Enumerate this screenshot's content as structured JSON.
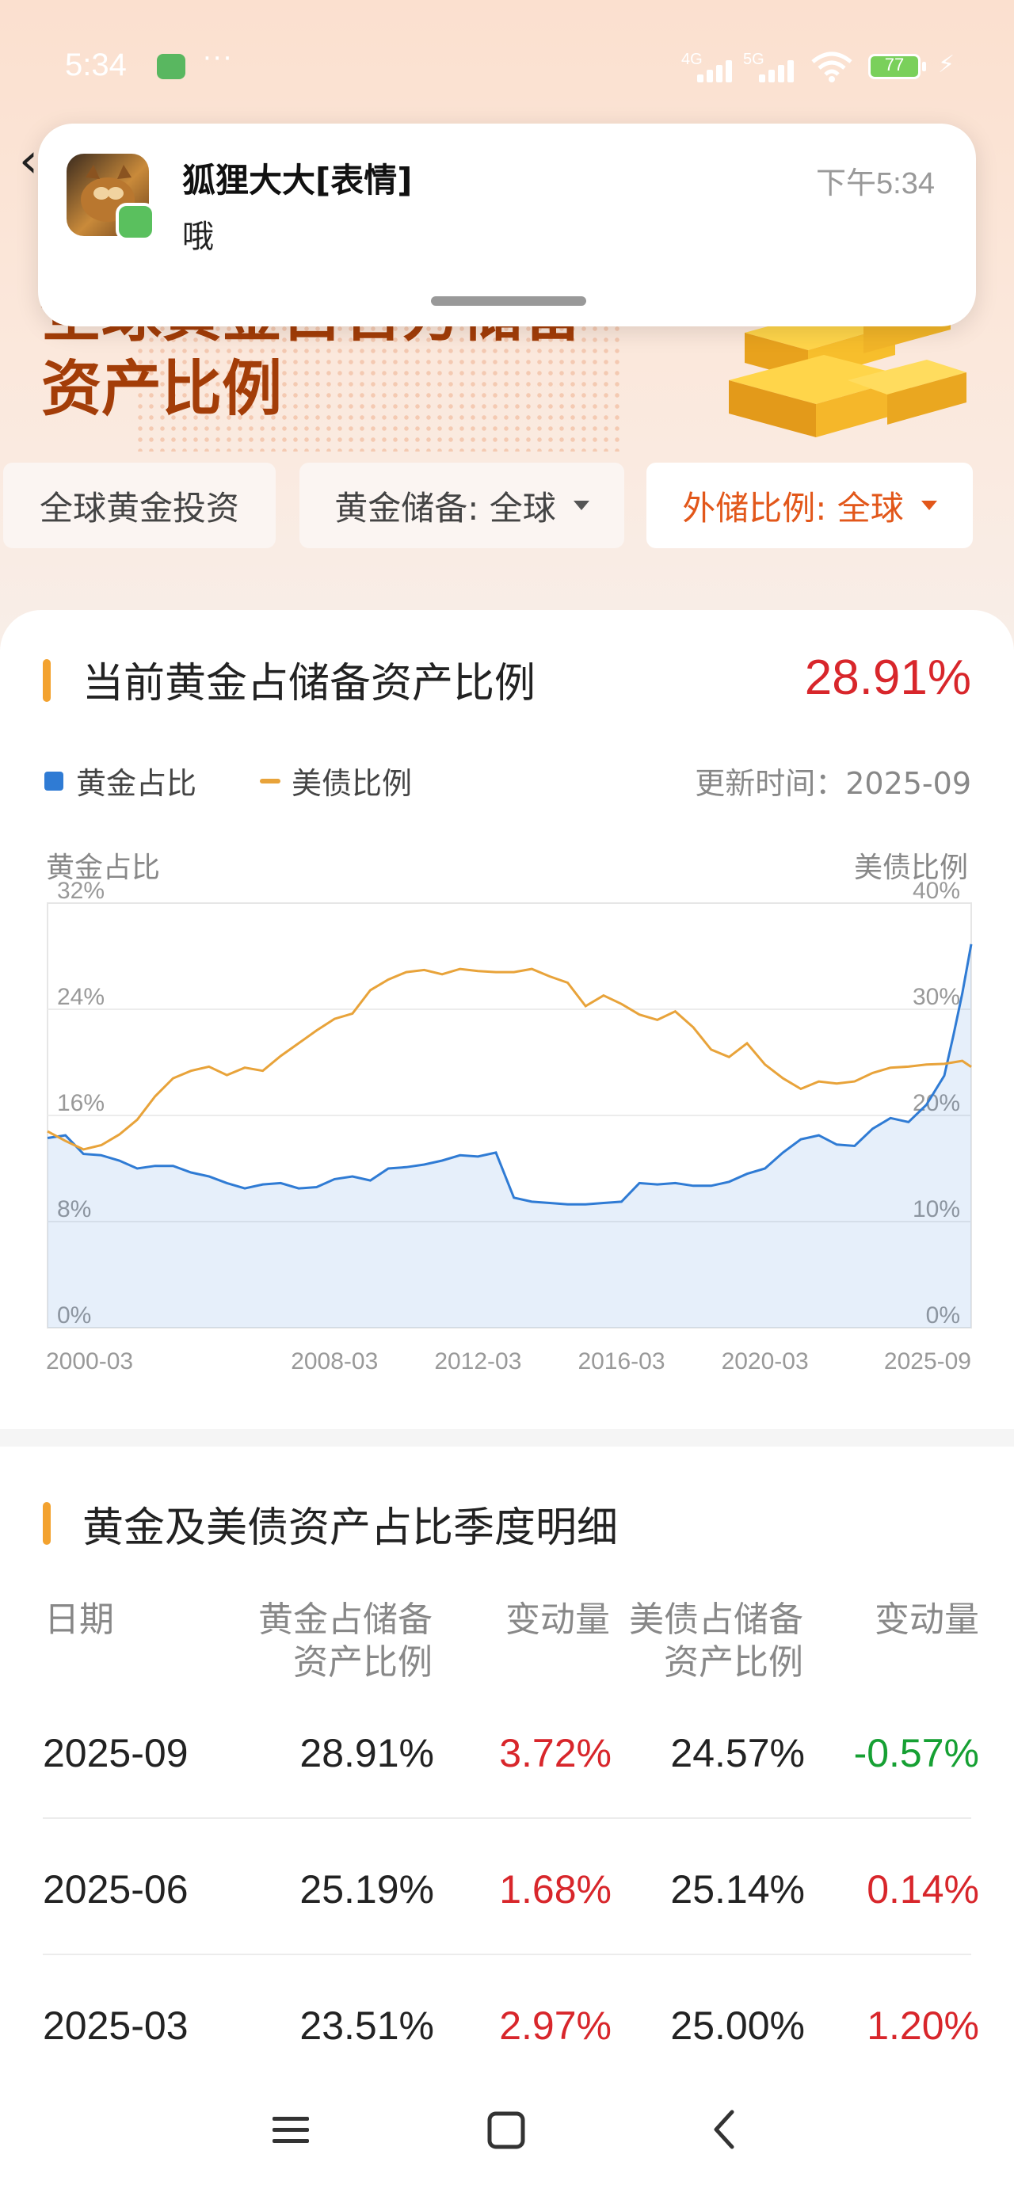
{
  "status_bar": {
    "time": "5:34",
    "dots": "···",
    "net1": "4G",
    "net2": "5G",
    "battery": "77"
  },
  "notification": {
    "sender": "狐狸大大[表情]",
    "message": "哦",
    "time": "下午5:34"
  },
  "hero": {
    "title_line1": "全球黄金占官方储备",
    "title_line2": "资产比例"
  },
  "tabs": [
    {
      "label": "全球黄金投资"
    },
    {
      "label": "黄金储备: 全球"
    },
    {
      "label": "外储比例: 全球"
    }
  ],
  "current": {
    "title": "当前黄金占储备资产比例",
    "value": "28.91%"
  },
  "legend": {
    "gold": "黄金占比",
    "treasury": "美债比例",
    "update": "更新时间：2025-09"
  },
  "colors": {
    "gold_series": "#2f7bd4",
    "treasury_series": "#e8a33a",
    "accent": "#e2571a",
    "up": "#d8262b",
    "down": "#16a033"
  },
  "chart_data": {
    "type": "line",
    "left_axis_title": "黄金占比",
    "right_axis_title": "美债比例",
    "left_ticks": [
      "32%",
      "24%",
      "16%",
      "8%",
      "0%"
    ],
    "right_ticks": [
      "40%",
      "30%",
      "20%",
      "10%",
      "0%"
    ],
    "x_ticks": [
      "2000-03",
      "2008-03",
      "2012-03",
      "2016-03",
      "2020-03",
      "2025-09"
    ],
    "left_range": [
      0,
      32
    ],
    "right_range": [
      0,
      40
    ],
    "x": [
      2000.0,
      2000.5,
      2001.0,
      2001.5,
      2002.0,
      2002.5,
      2003.0,
      2003.5,
      2004.0,
      2004.5,
      2005.0,
      2005.5,
      2006.0,
      2006.5,
      2007.0,
      2007.5,
      2008.0,
      2008.5,
      2009.0,
      2009.5,
      2010.0,
      2010.5,
      2011.0,
      2011.5,
      2012.0,
      2012.5,
      2013.0,
      2013.5,
      2014.0,
      2014.5,
      2015.0,
      2015.5,
      2016.0,
      2016.5,
      2017.0,
      2017.5,
      2018.0,
      2018.5,
      2019.0,
      2019.5,
      2020.0,
      2020.5,
      2021.0,
      2021.5,
      2022.0,
      2022.5,
      2023.0,
      2023.5,
      2024.0,
      2024.5,
      2025.0,
      2025.25,
      2025.5,
      2025.75
    ],
    "series": [
      {
        "name": "黄金占比",
        "axis": "left",
        "values": [
          14.3,
          14.5,
          13.1,
          13.0,
          12.6,
          12.0,
          12.2,
          12.2,
          11.7,
          11.4,
          10.9,
          10.5,
          10.8,
          10.9,
          10.5,
          10.6,
          11.2,
          11.4,
          11.1,
          12.0,
          12.1,
          12.3,
          12.6,
          13.0,
          12.9,
          13.2,
          9.8,
          9.5,
          9.4,
          9.3,
          9.3,
          9.4,
          9.5,
          10.9,
          10.8,
          10.9,
          10.7,
          10.7,
          11.0,
          11.6,
          12.0,
          13.2,
          14.2,
          14.5,
          13.8,
          13.7,
          15.0,
          15.8,
          15.5,
          16.8,
          19.0,
          22.0,
          25.19,
          28.91
        ]
      },
      {
        "name": "美债比例",
        "axis": "right",
        "values": [
          18.5,
          17.6,
          16.8,
          17.2,
          18.2,
          19.6,
          21.8,
          23.5,
          24.2,
          24.6,
          23.8,
          24.5,
          24.2,
          25.6,
          26.8,
          28.0,
          29.1,
          29.6,
          31.8,
          32.8,
          33.5,
          33.7,
          33.3,
          33.8,
          33.6,
          33.5,
          33.5,
          33.8,
          33.1,
          32.5,
          30.3,
          31.3,
          30.5,
          29.5,
          29.0,
          29.8,
          28.3,
          26.2,
          25.5,
          26.8,
          24.8,
          23.5,
          22.5,
          23.2,
          23.0,
          23.2,
          24.0,
          24.5,
          24.6,
          24.8,
          24.86,
          25.0,
          25.14,
          24.57
        ]
      }
    ]
  },
  "table": {
    "title": "黄金及美债资产占比季度明细",
    "headers": {
      "date": "日期",
      "gold_l1": "黄金占储备",
      "gold_l2": "资产比例",
      "change1": "变动量",
      "ust_l1": "美债占储备",
      "ust_l2": "资产比例",
      "change2": "变动量"
    },
    "rows": [
      {
        "date": "2025-09",
        "gold": "28.91%",
        "gold_change": "3.72%",
        "ust": "24.57%",
        "ust_change": "-0.57%"
      },
      {
        "date": "2025-06",
        "gold": "25.19%",
        "gold_change": "1.68%",
        "ust": "25.14%",
        "ust_change": "0.14%"
      },
      {
        "date": "2025-03",
        "gold": "23.51%",
        "gold_change": "2.97%",
        "ust": "25.00%",
        "ust_change": "1.20%"
      }
    ]
  },
  "nav_icons": [
    "menu-icon",
    "home-icon",
    "back-icon"
  ]
}
